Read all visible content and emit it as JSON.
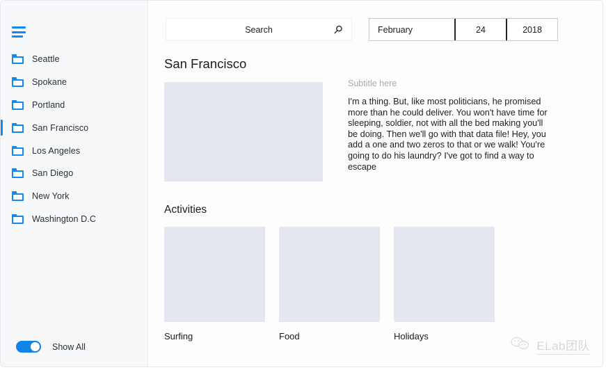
{
  "sidebar": {
    "menu_icon": "hamburger-icon",
    "items": [
      {
        "label": "Seattle",
        "icon": "folder-icon",
        "active": false
      },
      {
        "label": "Spokane",
        "icon": "folder-icon",
        "active": false
      },
      {
        "label": "Portland",
        "icon": "folder-icon",
        "active": false
      },
      {
        "label": "San Francisco",
        "icon": "folder-icon",
        "active": true
      },
      {
        "label": "Los Angeles",
        "icon": "folder-icon",
        "active": false
      },
      {
        "label": "San Diego",
        "icon": "folder-icon",
        "active": false
      },
      {
        "label": "New York",
        "icon": "folder-icon",
        "active": false
      },
      {
        "label": "Washington D.C",
        "icon": "folder-icon",
        "active": false
      }
    ],
    "toggle": {
      "label": "Show All",
      "state": "on"
    }
  },
  "topbar": {
    "search": {
      "value": "",
      "placeholder": "Search",
      "icon": "search-icon"
    },
    "date": {
      "month": "February",
      "day": "24",
      "year": "2018"
    }
  },
  "main": {
    "title": "San Francisco",
    "subtitle": "Subtitle here",
    "body": "I'm a thing. But, like most politicians, he promised more than he could deliver. You won't have time for sleeping, soldier, not with all the bed making you'll be doing. Then we'll go with that data file! Hey, you add a one and two zeros to that or we walk! You're going to do his laundry? I've got to find a way to escape",
    "hero_image": "image-placeholder",
    "section_title": "Activities",
    "cards": [
      {
        "label": "Surfing",
        "thumb": "image-placeholder"
      },
      {
        "label": "Food",
        "thumb": "image-placeholder"
      },
      {
        "label": "Holidays",
        "thumb": "image-placeholder"
      }
    ]
  },
  "watermark": {
    "text": "ELab团队",
    "icon": "chat-bubbles-icon"
  },
  "colors": {
    "accent": "#1089f0",
    "sidebar_bg": "#f7f8fa",
    "placeholder_fill": "#e4e7f0",
    "text": "#1a1c1e",
    "muted_text": "#a9abb0"
  }
}
